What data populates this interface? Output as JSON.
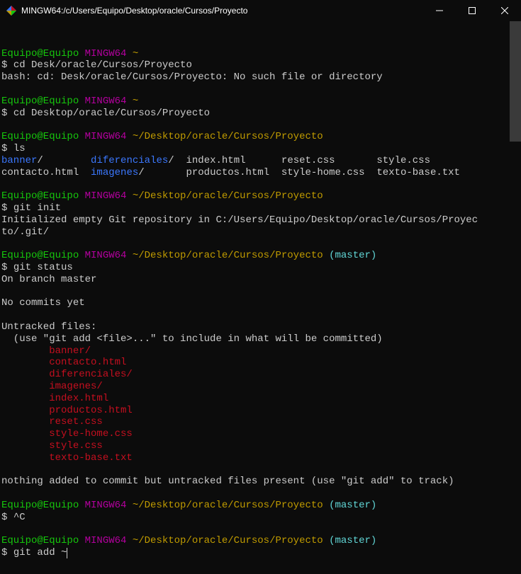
{
  "titlebar": {
    "title": "MINGW64:/c/Users/Equipo/Desktop/oracle/Cursos/Proyecto"
  },
  "block1": {
    "user": "Equipo@Equipo",
    "env": "MINGW64",
    "path": "~",
    "cmd": "cd Desk/oracle/Cursos/Proyecto",
    "out": "bash: cd: Desk/oracle/Cursos/Proyecto: No such file or directory"
  },
  "block2": {
    "user": "Equipo@Equipo",
    "env": "MINGW64",
    "path": "~",
    "cmd": "cd Desktop/oracle/Cursos/Proyecto"
  },
  "block3": {
    "user": "Equipo@Equipo",
    "env": "MINGW64",
    "path": "~/Desktop/oracle/Cursos/Proyecto",
    "cmd": "ls",
    "ls": {
      "banner": "banner",
      "diferenciales": "diferenciales",
      "index": "index.html",
      "reset": "reset.css",
      "style": "style.css",
      "contacto": "contacto.html",
      "imagenes": "imagenes",
      "productos": "productos.html",
      "stylehome": "style-home.css",
      "texto": "texto-base.txt"
    }
  },
  "block4": {
    "user": "Equipo@Equipo",
    "env": "MINGW64",
    "path": "~/Desktop/oracle/Cursos/Proyecto",
    "cmd": "git init",
    "out1": "Initialized empty Git repository in C:/Users/Equipo/Desktop/oracle/Cursos/Proyec",
    "out2": "to/.git/"
  },
  "block5": {
    "user": "Equipo@Equipo",
    "env": "MINGW64",
    "path": "~/Desktop/oracle/Cursos/Proyecto",
    "branch": "(master)",
    "cmd": "git status",
    "onbranch": "On branch master",
    "nocommits": "No commits yet",
    "untracked": "Untracked files:",
    "hint": "  (use \"git add <file>...\" to include in what will be committed)",
    "files": {
      "f1": "banner/",
      "f2": "contacto.html",
      "f3": "diferenciales/",
      "f4": "imagenes/",
      "f5": "index.html",
      "f6": "productos.html",
      "f7": "reset.css",
      "f8": "style-home.css",
      "f9": "style.css",
      "f10": "texto-base.txt"
    },
    "nothing": "nothing added to commit but untracked files present (use \"git add\" to track)"
  },
  "block6": {
    "user": "Equipo@Equipo",
    "env": "MINGW64",
    "path": "~/Desktop/oracle/Cursos/Proyecto",
    "branch": "(master)",
    "cmd": "^C"
  },
  "block7": {
    "user": "Equipo@Equipo",
    "env": "MINGW64",
    "path": "~/Desktop/oracle/Cursos/Proyecto",
    "branch": "(master)",
    "cmd": "git add ~"
  }
}
